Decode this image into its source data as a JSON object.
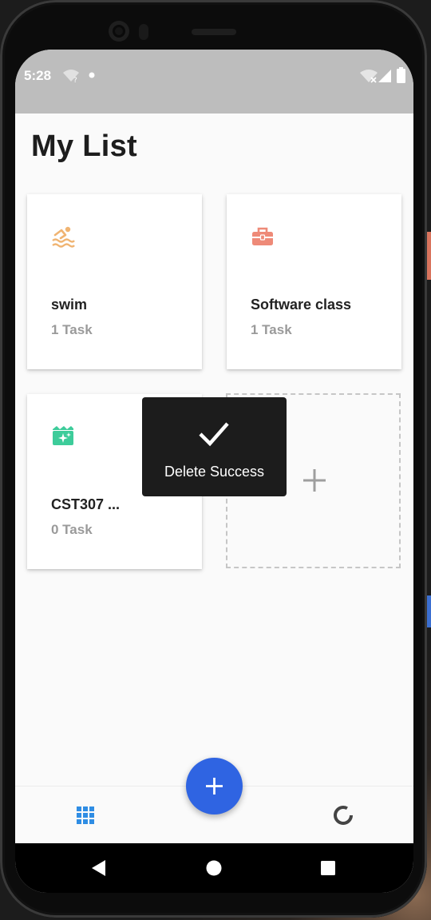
{
  "status_bar": {
    "time": "5:28"
  },
  "page": {
    "title": "My List"
  },
  "lists": [
    {
      "name": "swim",
      "count": "1 Task",
      "icon": "swimming-icon",
      "color": "#f0b472"
    },
    {
      "name": "Software class",
      "count": "1 Task",
      "icon": "briefcase-icon",
      "color": "#ee8a78"
    },
    {
      "name": "CST307 ...",
      "count": "0 Task",
      "icon": "movie-clapper-icon",
      "color": "#3dcc9a"
    }
  ],
  "toast": {
    "message": "Delete Success",
    "icon": "check-icon"
  },
  "fab": {
    "icon": "plus-icon",
    "color": "#2f64e2"
  },
  "bottom_nav": {
    "grid_icon": "grid-icon",
    "stats_icon": "donut-chart-icon",
    "active_color": "#2f8de4"
  },
  "colors": {
    "status_bar": "#bdbdbd",
    "background": "#fafafa",
    "toast": "#1c1c1c"
  }
}
